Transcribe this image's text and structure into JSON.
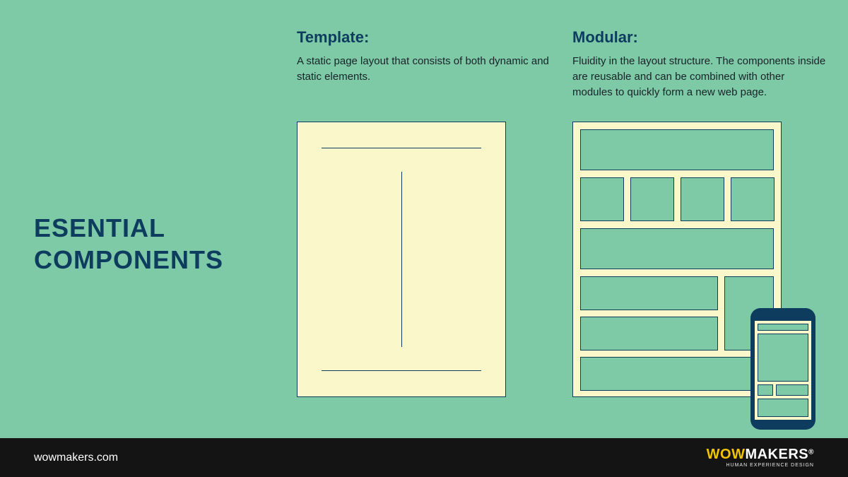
{
  "title": {
    "line1": "ESENTIAL",
    "line2": "COMPONENTS"
  },
  "template": {
    "heading": "Template:",
    "body": "A static page layout that consists of both dynamic and static elements."
  },
  "modular": {
    "heading": "Modular:",
    "body": "Fluidity in the layout structure. The components inside are reusable and can be combined with other modules to quickly form a new web page."
  },
  "footer": {
    "url": "wowmakers.com",
    "brand": {
      "wow": "WOW",
      "makers": "MAKERS",
      "reg": "®",
      "tagline": "HUMAN EXPERIENCE DESIGN"
    }
  }
}
